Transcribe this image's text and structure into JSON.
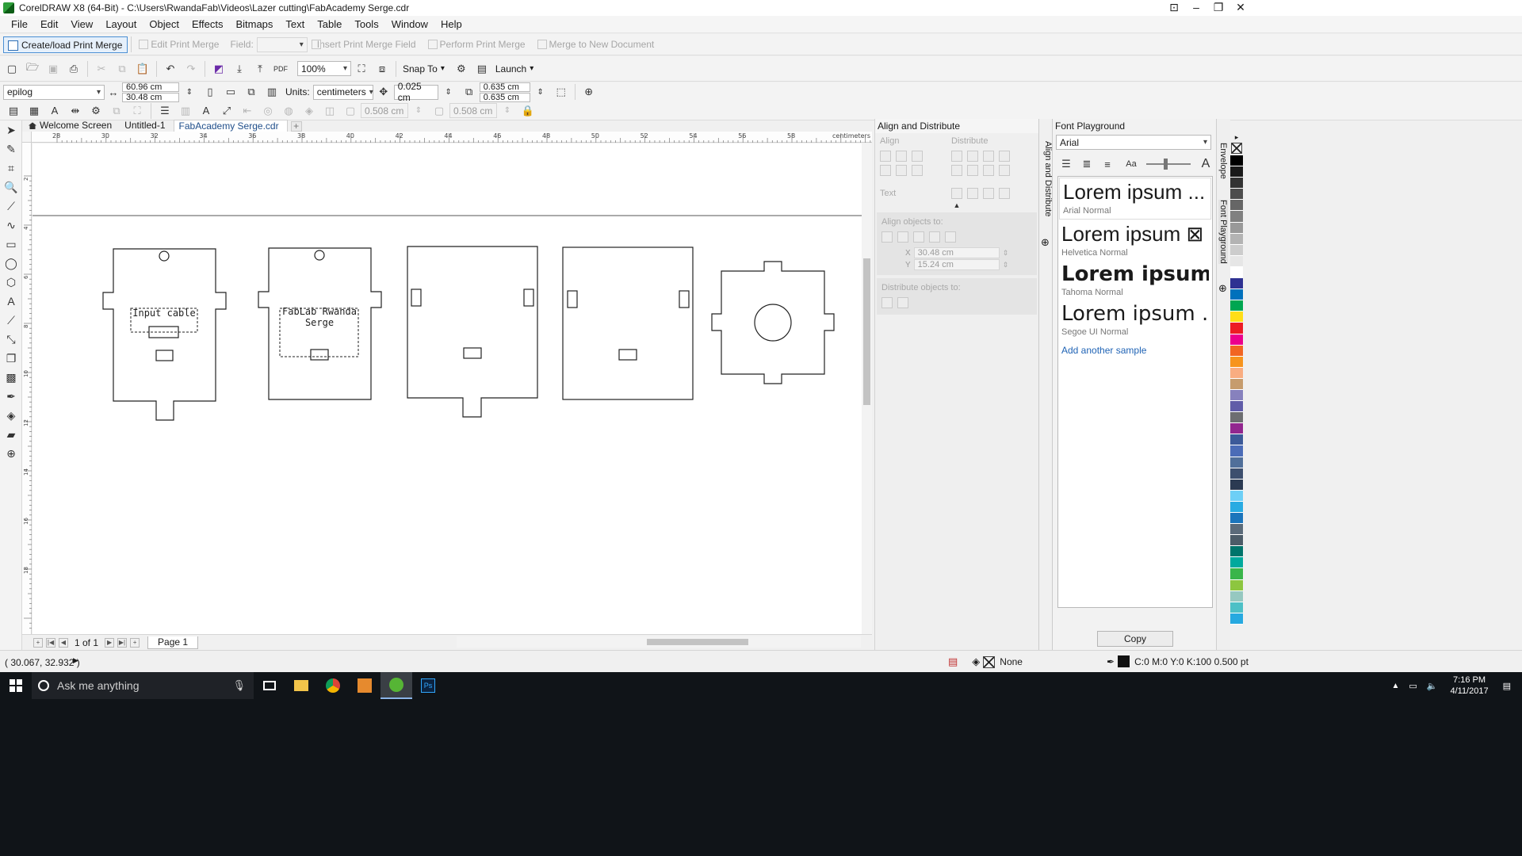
{
  "window": {
    "title": "CorelDRAW X8 (64-Bit) - C:\\Users\\RwandaFab\\Videos\\Lazer cutting\\FabAcademy Serge.cdr"
  },
  "menu": [
    "File",
    "Edit",
    "View",
    "Layout",
    "Object",
    "Effects",
    "Bitmaps",
    "Text",
    "Table",
    "Tools",
    "Window",
    "Help"
  ],
  "merge_toolbar": {
    "create_load": "Create/load Print Merge",
    "edit": "Edit Print Merge",
    "field_label": "Field:",
    "insert": "Insert Print Merge Field",
    "perform": "Perform Print Merge",
    "merge_new": "Merge to New Document"
  },
  "standard_toolbar": {
    "zoom": "100%",
    "snap_to": "Snap To",
    "launch": "Launch"
  },
  "property_bar": {
    "page_preset": "epilog",
    "width": "60.96 cm",
    "height": "30.48 cm",
    "units_label": "Units:",
    "units": "centimeters",
    "nudge": "0.025 cm",
    "dup_x": "0.635 cm",
    "dup_y": "0.635 cm",
    "val_a": "0.508 cm",
    "val_b": "0.508 cm"
  },
  "doc_tabs": [
    "Welcome Screen",
    "Untitled-1",
    "FabAcademy Serge.cdr"
  ],
  "ruler": {
    "unit": "centimeters",
    "h_ticks": [
      "28",
      "30",
      "32",
      "34",
      "36",
      "38",
      "40",
      "42",
      "44",
      "46",
      "48",
      "50",
      "52",
      "54",
      "56",
      "58"
    ],
    "v_ticks": [
      "2",
      "4",
      "6",
      "8",
      "10",
      "12",
      "14",
      "16",
      "18"
    ]
  },
  "canvas": {
    "label_input": "Input cable",
    "label_fablab": "FabLab Rwanda",
    "label_serge": "Serge"
  },
  "page_nav": {
    "counter": "1 of 1",
    "page_tab": "Page 1"
  },
  "align_docker": {
    "title": "Align and Distribute",
    "align": "Align",
    "distribute": "Distribute",
    "text": "Text",
    "align_objects_to": "Align objects to:",
    "x_value": "30.48 cm",
    "y_value": "15.24 cm",
    "distribute_objects_to": "Distribute objects to:",
    "tab_label": "Align and Distribute"
  },
  "font_docker": {
    "title": "Font Playground",
    "font": "Arial",
    "samples": [
      {
        "text": "Lorem ipsum ...",
        "name": "Arial Normal"
      },
      {
        "text": "Lorem ipsum ⊠",
        "name": "Helvetica Normal"
      },
      {
        "text": "Lorem ipsum ...",
        "name": "Tahoma Normal"
      },
      {
        "text": "Lorem ipsum ...",
        "name": "Segoe UI Normal"
      }
    ],
    "add_sample": "Add another sample",
    "copy": "Copy"
  },
  "right_strip": {
    "envelope": "Envelope",
    "font_playground": "Font Playground"
  },
  "palette": [
    "#000000",
    "#1a1a1a",
    "#333333",
    "#4d4d4d",
    "#666666",
    "#808080",
    "#999999",
    "#b3b3b3",
    "#cccccc",
    "#e6e6e6",
    "#ffffff",
    "#2e3192",
    "#0071bc",
    "#00a651",
    "#ffde17",
    "#ed1c24",
    "#ec008c",
    "#f26522",
    "#f7941d",
    "#f9ad81",
    "#c69c6d",
    "#8781bd",
    "#605ca8",
    "#6d6e71",
    "#92278f",
    "#3c5a99",
    "#4b6cb7",
    "#506f9a",
    "#3d4f6e",
    "#2b3a52",
    "#6dcff6",
    "#29abe2",
    "#1b75bc",
    "#5b6b7a",
    "#4c5c68",
    "#00746b",
    "#00a99d",
    "#39b54a",
    "#8dc63f",
    "#96c8c0",
    "#4dc0c6",
    "#26a9e0"
  ],
  "status": {
    "coords": "( 30.067, 32.932 )",
    "fill": "None",
    "outline": "C:0 M:0 Y:0 K:100  0.500 pt"
  },
  "taskbar": {
    "search": "Ask me anything",
    "time": "7:16 PM",
    "date": "4/11/2017"
  }
}
